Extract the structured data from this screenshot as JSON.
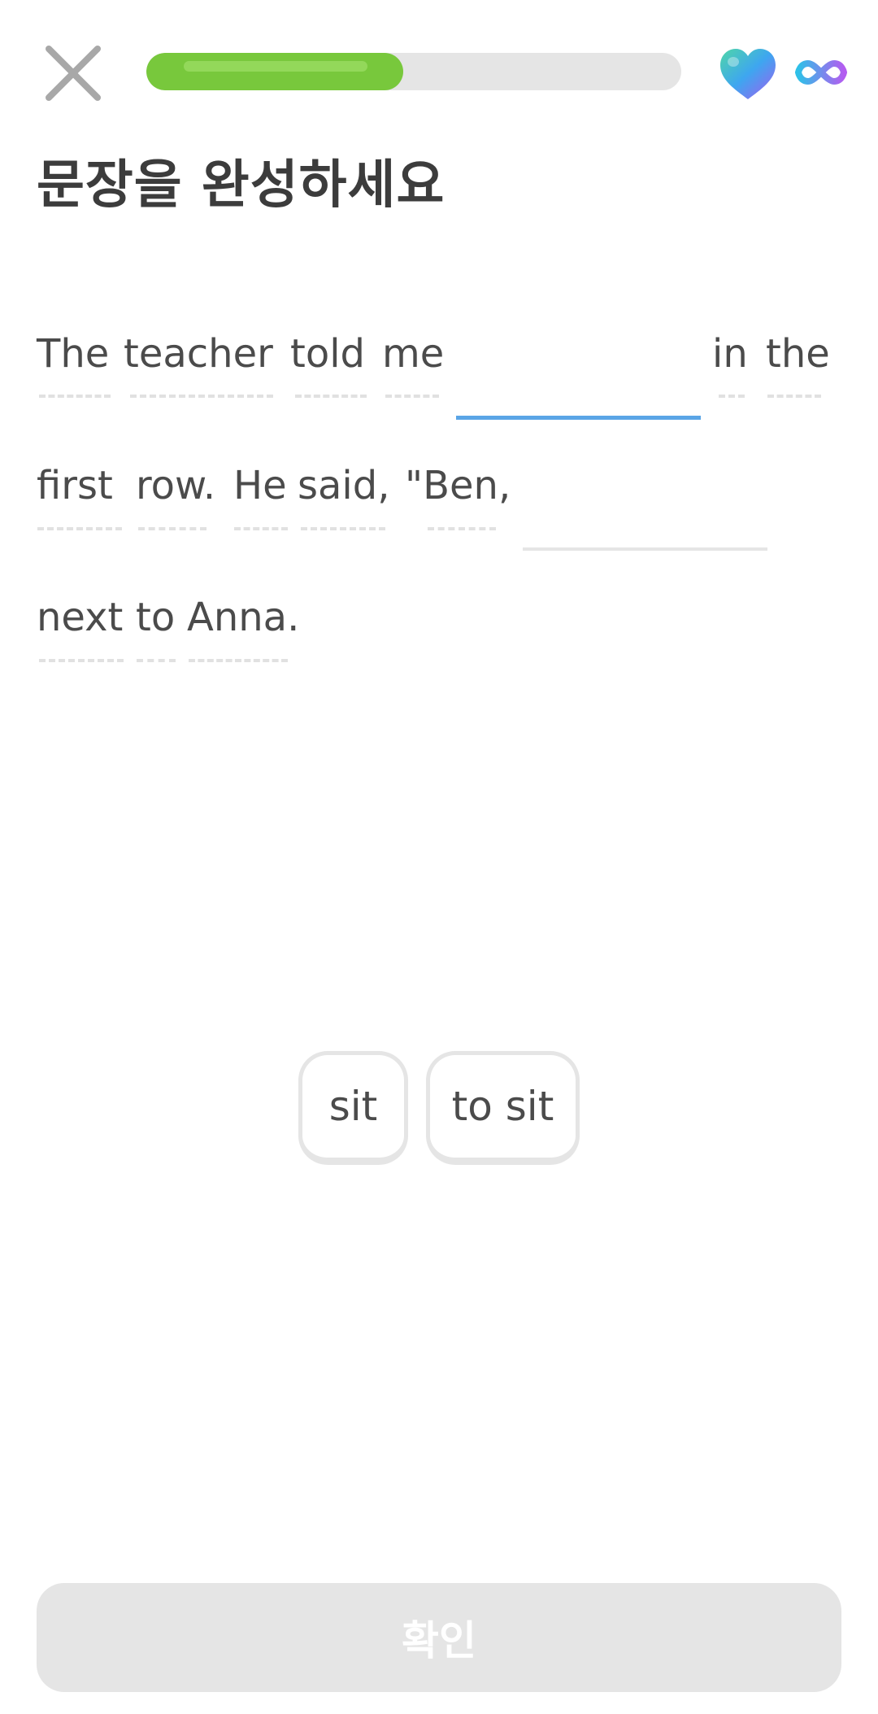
{
  "header": {
    "progress_fraction": 0.48,
    "close_icon": "close-icon",
    "heart_icon": "heart-icon",
    "lives_icon": "infinity-icon"
  },
  "instruction": "문장을 완성하세요",
  "sentence": {
    "line1": [
      "The",
      "teacher",
      "told",
      "me",
      "in",
      "the"
    ],
    "line2": [
      "first",
      "row.",
      "He",
      "said,",
      "\"Ben,"
    ],
    "line3": [
      "next",
      "to",
      "Anna."
    ]
  },
  "choices": [
    "sit",
    "to sit"
  ],
  "footer": {
    "check_label": "확인"
  },
  "colors": {
    "progress": "#78c83c",
    "active_blank": "#5aa5e6",
    "disabled_button": "#e5e5e5"
  }
}
